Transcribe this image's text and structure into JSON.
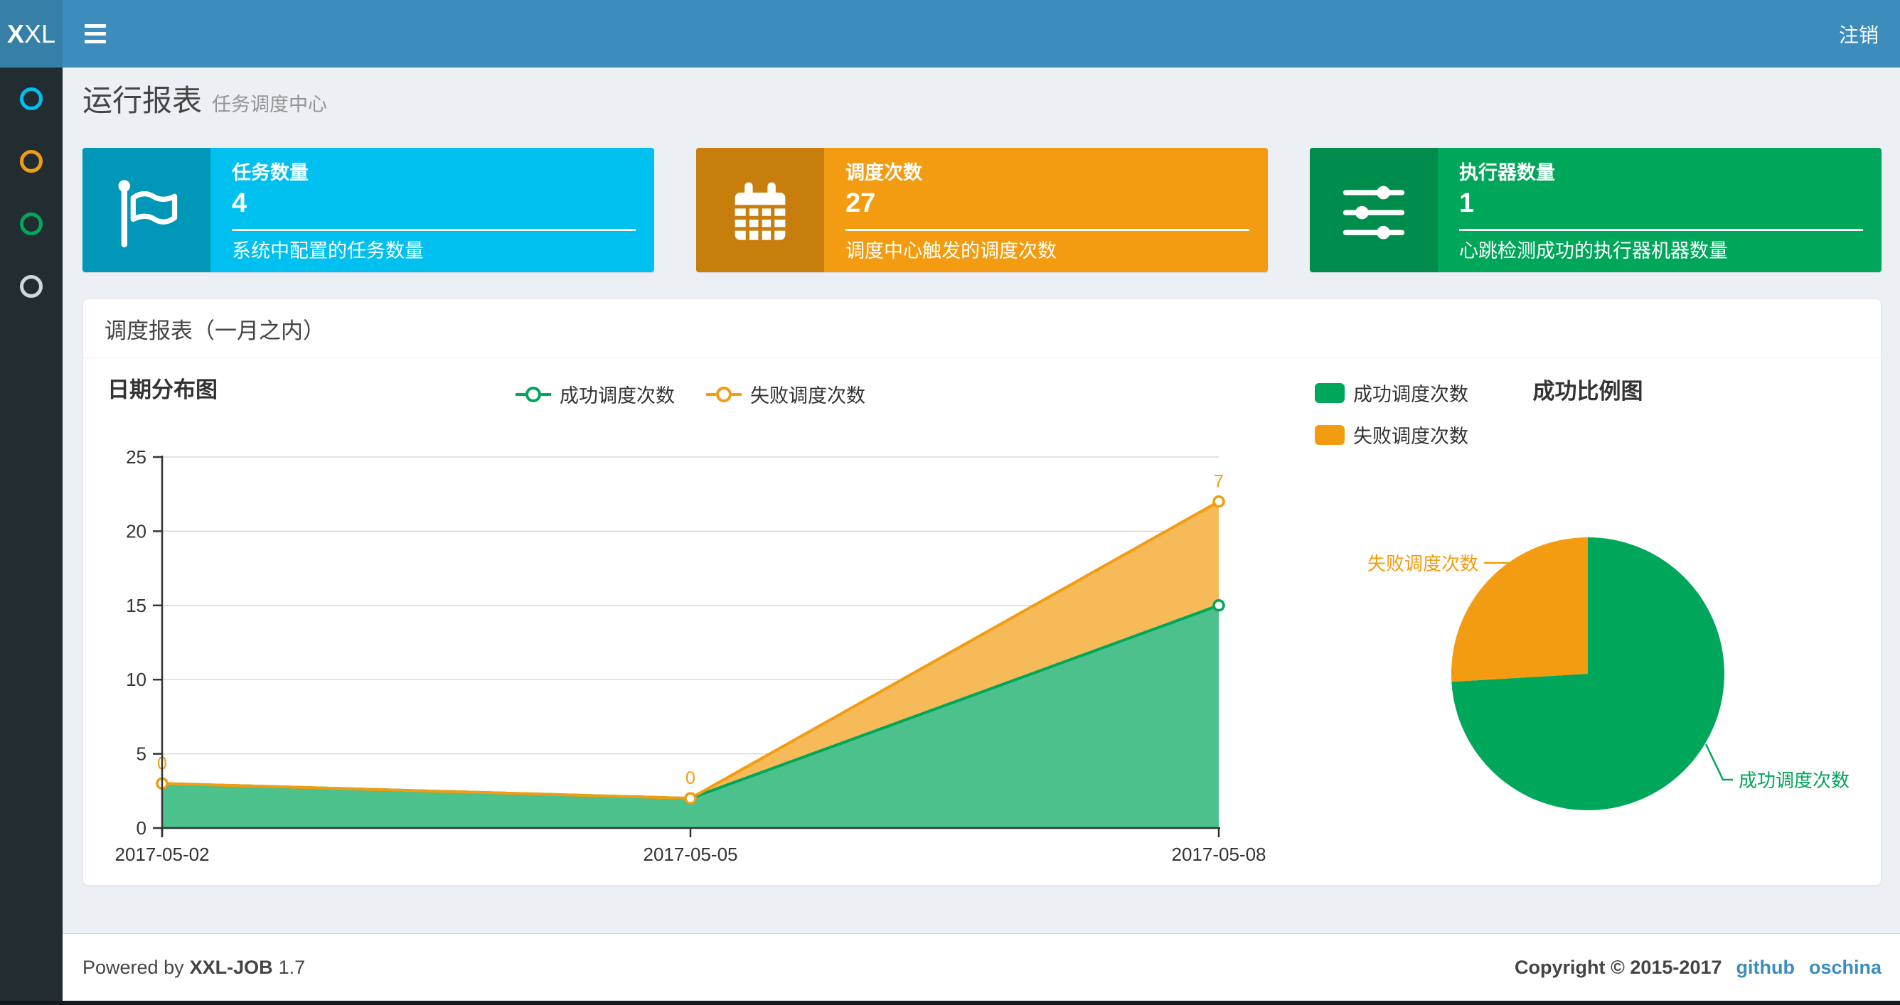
{
  "header": {
    "logo_bold": "X",
    "logo_rest": "XL",
    "logout_label": "注销"
  },
  "sidebar": {
    "items": [
      {
        "id": "item-1",
        "icon": "circle-o-icon",
        "color": "#00c0ef"
      },
      {
        "id": "item-2",
        "icon": "circle-o-icon",
        "color": "#f39c12"
      },
      {
        "id": "item-3",
        "icon": "circle-o-icon",
        "color": "#00a65a"
      },
      {
        "id": "item-4",
        "icon": "circle-o-icon",
        "color": "#d2d6de"
      }
    ]
  },
  "page": {
    "title": "运行报表",
    "subtitle": "任务调度中心"
  },
  "cards": [
    {
      "label": "任务数量",
      "value": "4",
      "desc": "系统中配置的任务数量",
      "color": "#00c0ef",
      "icon_color": "#0097b8",
      "icon": "flag-icon"
    },
    {
      "label": "调度次数",
      "value": "27",
      "desc": "调度中心触发的调度次数",
      "color": "#f39c12",
      "icon_color": "#c77e0c",
      "icon": "calendar-icon"
    },
    {
      "label": "执行器数量",
      "value": "1",
      "desc": "心跳检测成功的执行器机器数量",
      "color": "#00a65a",
      "icon_color": "#008c4c",
      "icon": "sliders-icon"
    }
  ],
  "panel": {
    "title": "调度报表（一月之内）"
  },
  "chart_data": [
    {
      "type": "area",
      "title": "日期分布图",
      "x": [
        "2017-05-02",
        "2017-05-05",
        "2017-05-08"
      ],
      "series": [
        {
          "name": "成功调度次数",
          "values": [
            3,
            2,
            15
          ],
          "color": "#00a65a",
          "area_color": "#4dc18c",
          "show_point_labels": false
        },
        {
          "name": "失败调度次数",
          "values": [
            0,
            0,
            7
          ],
          "color": "#f39c12",
          "area_color": "#f7ba59",
          "show_point_labels": true
        }
      ],
      "stacked": true,
      "ylim": [
        0,
        25
      ],
      "ystep": 5,
      "grid": true,
      "legend_position": "top-center"
    },
    {
      "type": "pie",
      "title": "成功比例图",
      "slices": [
        {
          "name": "成功调度次数",
          "value": 20,
          "color": "#00a65a"
        },
        {
          "name": "失败调度次数",
          "value": 7,
          "color": "#f39c12"
        }
      ],
      "start_angle": 90,
      "clockwise": true,
      "legend_position": "top-left",
      "labels": "leader-line"
    }
  ],
  "footer": {
    "powered_by": "Powered by",
    "brand": "XXL-JOB",
    "version": "1.7",
    "copyright": "Copyright © 2015-2017",
    "links": [
      {
        "label": "github"
      },
      {
        "label": "oschina"
      }
    ]
  }
}
